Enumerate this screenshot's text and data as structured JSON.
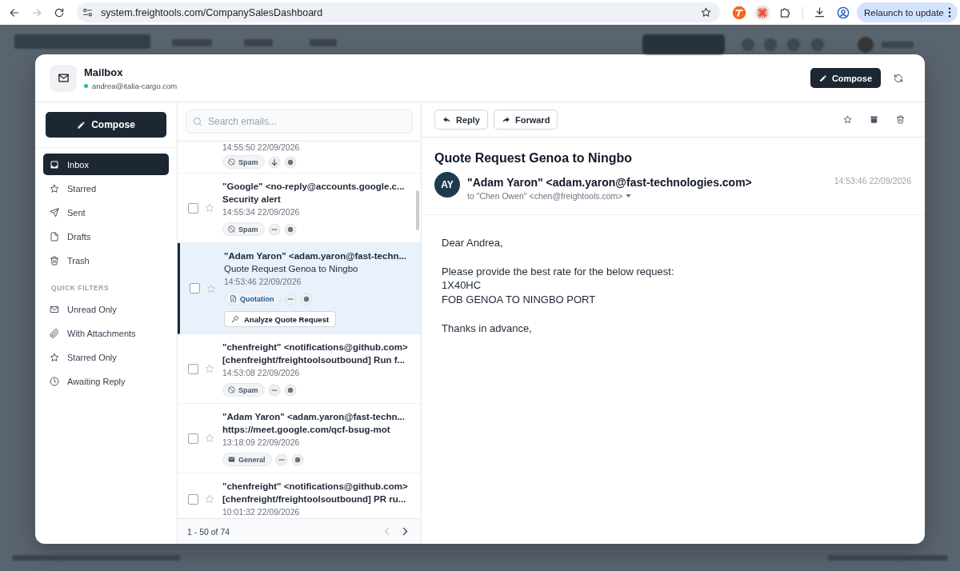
{
  "browser": {
    "back_disabled": false,
    "forward_disabled": true,
    "url": "system.freightools.com/CompanySalesDashboard",
    "bookmarked": false,
    "update_label": "Relaunch to update"
  },
  "mailbox": {
    "title": "Mailbox",
    "account": "andrea@italia-cargo.com",
    "online": true,
    "compose": "Compose"
  },
  "sidebar": {
    "compose": "Compose",
    "folders": [
      {
        "label": "Inbox",
        "selected": true
      },
      {
        "label": "Starred",
        "selected": false
      },
      {
        "label": "Sent",
        "selected": false
      },
      {
        "label": "Drafts",
        "selected": false
      },
      {
        "label": "Trash",
        "selected": false
      }
    ],
    "filters_heading": "QUICK FILTERS",
    "filters": [
      {
        "label": "Unread Only",
        "selected": false
      },
      {
        "label": "With Attachments",
        "selected": false
      },
      {
        "label": "Starred Only",
        "selected": false
      },
      {
        "label": "Awaiting Reply",
        "selected": false
      }
    ]
  },
  "email_list": {
    "search_placeholder": "Search emails...",
    "emails": [
      {
        "time": "14:55:50 22/09/2026",
        "selected": false,
        "tags": [
          {
            "kind": "spam",
            "label": "Spam"
          }
        ],
        "markers": [
          {
            "kind": "down"
          },
          {
            "kind": "dot"
          }
        ]
      },
      {
        "sender": "\"Google\" <no-reply@accounts.google.c...",
        "subject": "Security alert",
        "time": "14:55:34 22/09/2026",
        "unread": true,
        "selected": false,
        "checked": false,
        "starred": false,
        "tags": [
          {
            "kind": "spam",
            "label": "Spam"
          }
        ],
        "markers": [
          {
            "kind": "dash"
          },
          {
            "kind": "dot"
          }
        ]
      },
      {
        "sender": "\"Adam Yaron\" <adam.yaron@fast-techn...",
        "subject": "Quote Request Genoa to Ningbo",
        "time": "14:53:46 22/09/2026",
        "unread": false,
        "selected": true,
        "checked": false,
        "starred": false,
        "tags": [
          {
            "kind": "quotation",
            "label": "Quotation"
          }
        ],
        "markers": [
          {
            "kind": "dash"
          },
          {
            "kind": "dot"
          }
        ],
        "action": "Analyze Quote Request"
      },
      {
        "sender": "\"chenfreight\" <notifications@github.com>",
        "subject": "[chenfreight/freightoolsoutbound] Run f...",
        "time": "14:53:08 22/09/2026",
        "unread": true,
        "selected": false,
        "checked": false,
        "starred": false,
        "tags": [
          {
            "kind": "spam",
            "label": "Spam"
          }
        ],
        "markers": [
          {
            "kind": "dash"
          },
          {
            "kind": "dot"
          }
        ]
      },
      {
        "sender": "\"Adam Yaron\" <adam.yaron@fast-techn...",
        "subject": "https://meet.google.com/qcf-bsug-mot",
        "time": "13:18:09 22/09/2026",
        "unread": true,
        "selected": false,
        "checked": false,
        "starred": false,
        "tags": [
          {
            "kind": "general",
            "label": "General"
          }
        ],
        "markers": [
          {
            "kind": "dash"
          },
          {
            "kind": "dot"
          }
        ]
      },
      {
        "sender": "\"chenfreight\" <notifications@github.com>",
        "subject": "[chenfreight/freightoolsoutbound] PR ru...",
        "time": "10:01:32 22/09/2026",
        "unread": true,
        "selected": false,
        "checked": false,
        "starred": false
      }
    ],
    "range": "1 - 50 of 74",
    "prev_disabled": true,
    "next_disabled": false
  },
  "reader": {
    "reply": "Reply",
    "forward": "Forward",
    "starred": false,
    "subject": "Quote Request Genoa to Ningbo",
    "initials": "AY",
    "from": "\"Adam Yaron\" <adam.yaron@fast-technologies.com>",
    "to": "to \"Chen Owen\" <chen@freightools.com>",
    "date": "14:53:46 22/09/2026",
    "body": [
      "Dear Andrea,",
      "Please provide the best rate for the below request:\n1X40HC\nFOB GENOA TO NINGBO PORT",
      "Thanks in advance,"
    ]
  }
}
